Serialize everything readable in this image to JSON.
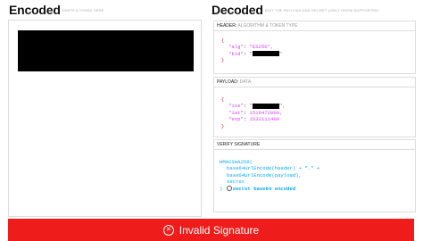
{
  "encoded": {
    "title": "Encoded",
    "subtitle": "PASTE A TOKEN HERE"
  },
  "decoded": {
    "title": "Decoded",
    "subtitle": "EDIT THE PAYLOAD AND SECRET (ONLY HS256 SUPPORTED)"
  },
  "header_section": {
    "label": "HEADER:",
    "label_muted": "ALGORITHM & TOKEN TYPE",
    "open": "{",
    "alg_key": "\"alg\"",
    "alg_value": "\"ES256\",",
    "kid_key": "\"kid\"",
    "kid_value_start": "\"",
    "kid_value_end": "\"",
    "close": "}"
  },
  "payload_section": {
    "label": "PAYLOAD:",
    "label_muted": "DATA",
    "open": "{",
    "iss_key": "\"iss\"",
    "iss_value_start": "\"",
    "iss_value_end": "\",",
    "iat_key": "\"iat\"",
    "iat_value": "1516472000,",
    "exp_key": "\"exp\"",
    "exp_value": "1532111400",
    "close": "}"
  },
  "signature_section": {
    "label": "VERIFY SIGNATURE",
    "line1": "HMACSHA256(",
    "line2": "base64UrlEncode(header) + \".\" +",
    "line3": "base64UrlEncode(payload),",
    "line4": "secret",
    "line5_close": ")",
    "secret_checkbox_label": "secret base64 encoded"
  },
  "status": {
    "label": "Invalid Signature",
    "color": "#ef1c1c"
  },
  "colors": {
    "key": "#d63aff",
    "signature": "#03a9f4",
    "error": "#ef1c1c"
  }
}
